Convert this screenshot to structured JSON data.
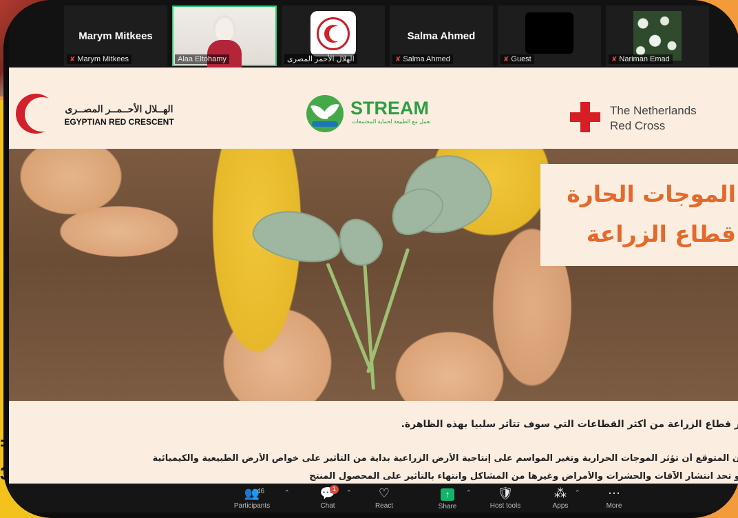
{
  "background": {
    "side_chars": [
      "=",
      "3"
    ]
  },
  "strip": {
    "tiles": [
      {
        "big_name": "Marym Mitkees",
        "label": "Marym Mitkees",
        "muted": true
      },
      {
        "big_name": "",
        "label": "Alaa Eltohamy",
        "muted": false,
        "speaking": true
      },
      {
        "big_name": "",
        "label": "الهلال الأحمر المصرى",
        "muted": false
      },
      {
        "big_name": "Salma Ahmed",
        "label": "Salma Ahmed",
        "muted": true
      },
      {
        "big_name": "",
        "label": "Guest",
        "muted": true
      },
      {
        "big_name": "",
        "label": "Nariman Emad",
        "muted": true
      }
    ]
  },
  "slide": {
    "logos": {
      "erc_arabic": "الهــلال الأحــمــر المصــرى",
      "erc_english": "EGYPTIAN RED CRESCENT",
      "stream_name": "STREAM",
      "stream_tagline": "نعمل مع الطبيعة لحماية المجتمعات",
      "nrc_line1": "The Netherlands",
      "nrc_line2": "Red Cross"
    },
    "title_line1": "الموجات الحارة",
    "title_line2": "قطاع الزراعة",
    "paragraph1": "ر قطاع الزراعة من أكثر القطاعات التي سوف تتأثر سلبيا بهذه الظاهرة.",
    "paragraph2": "ن المتوقع أن تؤثر الموجات الحرارية وتغير المواسم على إنتاجية الأرض الزراعية بداية من التأثير على خواص الأرض الطبيعية والكيميائية",
    "paragraph3": "و تحد انتشار الآفات والحشرات والأمراض وغيرها من المشاكل وانتهاء بالتأثير على المحصول المنتج"
  },
  "toolbar": {
    "participants_label": "Participants",
    "participants_count": "46",
    "chat_label": "Chat",
    "chat_badge": "1",
    "react_label": "React",
    "share_label": "Share",
    "host_tools_label": "Host tools",
    "apps_label": "Apps",
    "more_label": "More"
  },
  "icons": [
    "participants-icon",
    "chat-icon",
    "react-icon",
    "share-icon",
    "host-tools-icon",
    "apps-icon",
    "more-icon",
    "muted-mic-icon"
  ],
  "colors": {
    "zoom_share_green": "#14b36a",
    "speaking_outline": "#2ecc71",
    "muted_red": "#e0463c",
    "slide_title_orange": "#e4692a",
    "red_cross": "#d81e25",
    "stream_green": "#2f9e44"
  }
}
